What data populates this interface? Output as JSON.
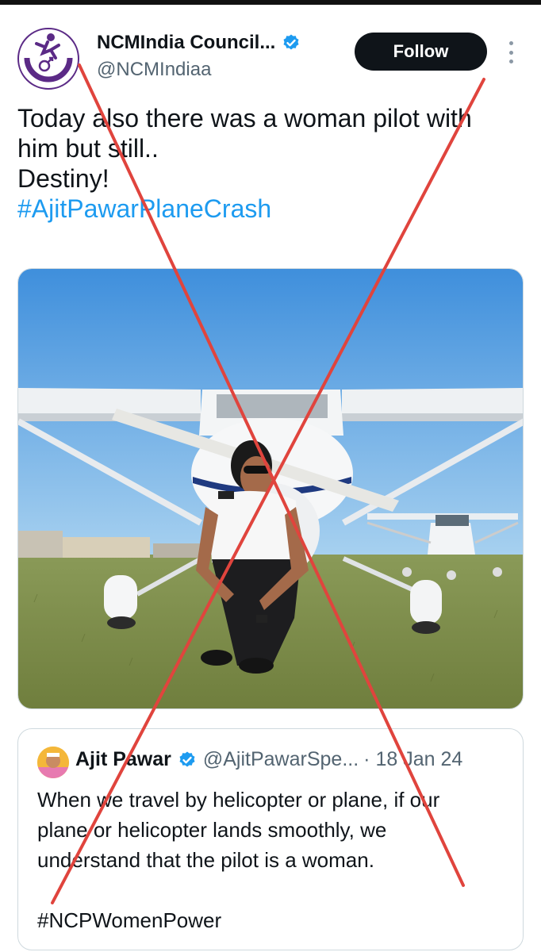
{
  "account": {
    "name": "NCMIndia Council...",
    "handle": "@NCMIndiaa",
    "follow_label": "Follow"
  },
  "tweet": {
    "lines": [
      "Today also there was a woman pilot with",
      "him but still..",
      "Destiny!"
    ],
    "hashtag": "#AjitPawarPlaneCrash"
  },
  "quoted_tweet": {
    "name": "Ajit Pawar",
    "handle": "@AjitPawarSpe...",
    "date": "· 18 Jan 24",
    "lines": [
      "When we travel by helicopter or plane, if our",
      "plane or helicopter lands smoothly, we",
      "understand that the pilot is a woman."
    ],
    "hashtag": "#NCPWomenPower"
  },
  "colors": {
    "link": "#1d9bf0",
    "verified": "#1d9bf0",
    "cross": "#e0443d",
    "follow_bg": "#0f1419"
  },
  "icons": {
    "verified": "verified-badge-icon",
    "more": "more-vertical-icon"
  }
}
